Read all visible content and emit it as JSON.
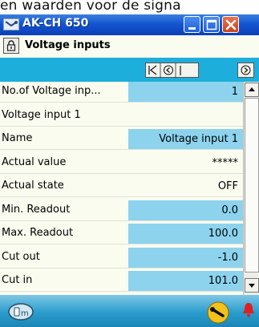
{
  "caption": "en waarden voor de signa",
  "window": {
    "title": "AK-CH 650",
    "controls": [
      "minimize",
      "maximize",
      "close"
    ]
  },
  "toolbar": {
    "screen_title": "Voltage inputs",
    "lock_icon": "padlock-icon"
  },
  "navigation": {
    "buttons": [
      "first-icon",
      "previous-icon",
      "next-icon"
    ]
  },
  "rows": [
    {
      "label": "No.of Voltage inp...",
      "value": "1",
      "editable": true
    },
    {
      "label": "Voltage input 1",
      "value": "",
      "editable": false
    },
    {
      "label": "Name",
      "value": "Voltage input 1",
      "editable": true
    },
    {
      "label": "Actual value",
      "value": "*****",
      "editable": false
    },
    {
      "label": "Actual state",
      "value": "OFF",
      "editable": false
    },
    {
      "label": "Min. Readout",
      "value": "0.0",
      "editable": true
    },
    {
      "label": "Max. Readout",
      "value": "100.0",
      "editable": true
    },
    {
      "label": "Cut out",
      "value": "-1.0",
      "editable": true
    },
    {
      "label": "Cut in",
      "value": "101.0",
      "editable": true
    }
  ],
  "status": {
    "icons": [
      "operator-icon",
      "service-wrench-icon",
      "alarm-bell-icon"
    ],
    "alarm_color": "#e02020",
    "accent_color": "#1eaedb"
  }
}
